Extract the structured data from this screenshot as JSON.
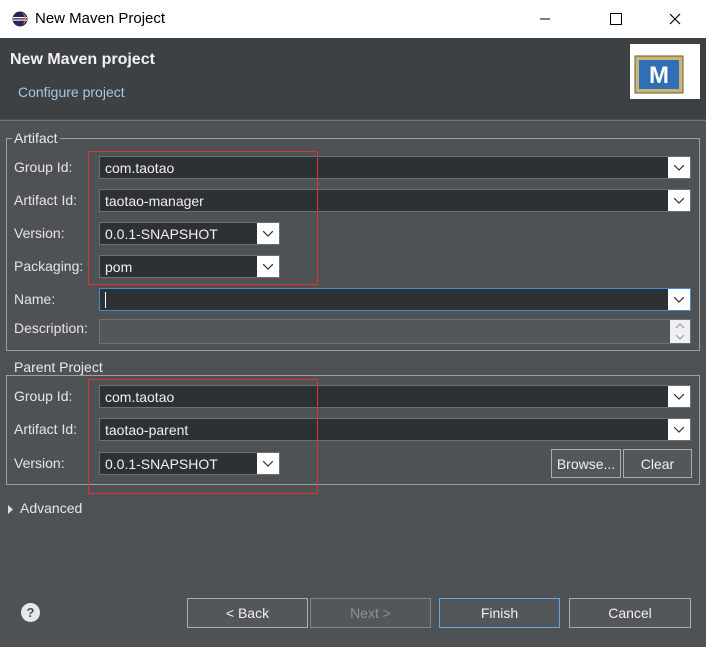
{
  "window": {
    "title": "New Maven Project",
    "minimize": "—",
    "maximize": "☐",
    "close": "✕"
  },
  "banner": {
    "heading": "New Maven project",
    "subheading": "Configure project",
    "logo_letter": "M"
  },
  "artifact": {
    "group_title": "Artifact",
    "group_id_label": "Group Id:",
    "group_id_value": "com.taotao",
    "artifact_id_label": "Artifact Id:",
    "artifact_id_value": "taotao-manager",
    "version_label": "Version:",
    "version_value": "0.0.1-SNAPSHOT",
    "packaging_label": "Packaging:",
    "packaging_value": "pom",
    "name_label": "Name:",
    "name_value": "",
    "description_label": "Description:",
    "description_value": ""
  },
  "parent": {
    "group_title": "Parent Project",
    "group_id_label": "Group Id:",
    "group_id_value": "com.taotao",
    "artifact_id_label": "Artifact Id:",
    "artifact_id_value": "taotao-parent",
    "version_label": "Version:",
    "version_value": "0.0.1-SNAPSHOT",
    "browse_label": "Browse...",
    "clear_label": "Clear"
  },
  "advanced": {
    "label": "Advanced"
  },
  "footer": {
    "help": "?",
    "back_label": "< Back",
    "next_label": "Next >",
    "finish_label": "Finish",
    "cancel_label": "Cancel"
  }
}
